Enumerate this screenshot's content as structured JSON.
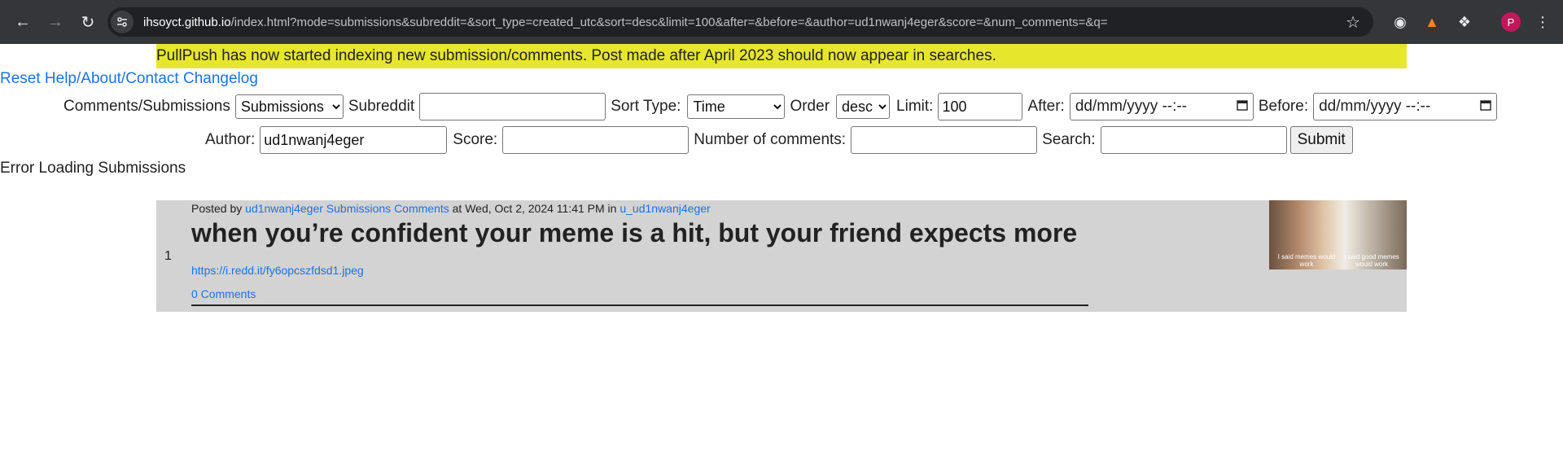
{
  "browser": {
    "url_host": "ihsoyct.github.io",
    "url_rest": "/index.html?mode=submissions&subreddit=&sort_type=created_utc&sort=desc&limit=100&after=&before=&author=ud1nwanj4eger&score=&num_comments=&q=",
    "profile_initial": "P"
  },
  "banner": "PullPush has now started indexing new submission/comments. Post made after April 2023 should now appear in searches.",
  "toplinks": {
    "reset": "Reset",
    "help": "Help/About/Contact",
    "changelog": "Changelog"
  },
  "form": {
    "mode_label": "Comments/Submissions",
    "mode_value": "Submissions",
    "subreddit_label": "Subreddit",
    "subreddit_value": "",
    "sort_type_label": "Sort Type:",
    "sort_type_value": "Time",
    "order_label": "Order",
    "order_value": "desc",
    "limit_label": "Limit:",
    "limit_value": "100",
    "after_label": "After:",
    "after_placeholder": "dd/mm/yyyy  --:--",
    "before_label": "Before:",
    "before_placeholder": "dd/mm/yyyy  --:--",
    "author_label": "Author:",
    "author_value": "ud1nwanj4eger",
    "score_label": "Score:",
    "score_value": "",
    "num_comments_label": "Number of comments:",
    "num_comments_value": "",
    "search_label": "Search:",
    "search_value": "",
    "submit_label": "Submit"
  },
  "error_text": "Error Loading Submissions",
  "submission": {
    "rank": "1",
    "posted_by": "Posted by",
    "author": "ud1nwanj4eger",
    "submissions_link": "Submissions",
    "comments_link_top": "Comments",
    "at": "at Wed, Oct 2, 2024 11:41 PM in",
    "subreddit": "u_ud1nwanj4eger",
    "title": "when you’re confident your meme is a hit, but your friend expects more",
    "url": "https://i.redd.it/fy6opcszfdsd1.jpeg",
    "comments": "0 Comments",
    "thumb_caption_left": "I said memes would work",
    "thumb_caption_right": "I said good memes would work"
  }
}
